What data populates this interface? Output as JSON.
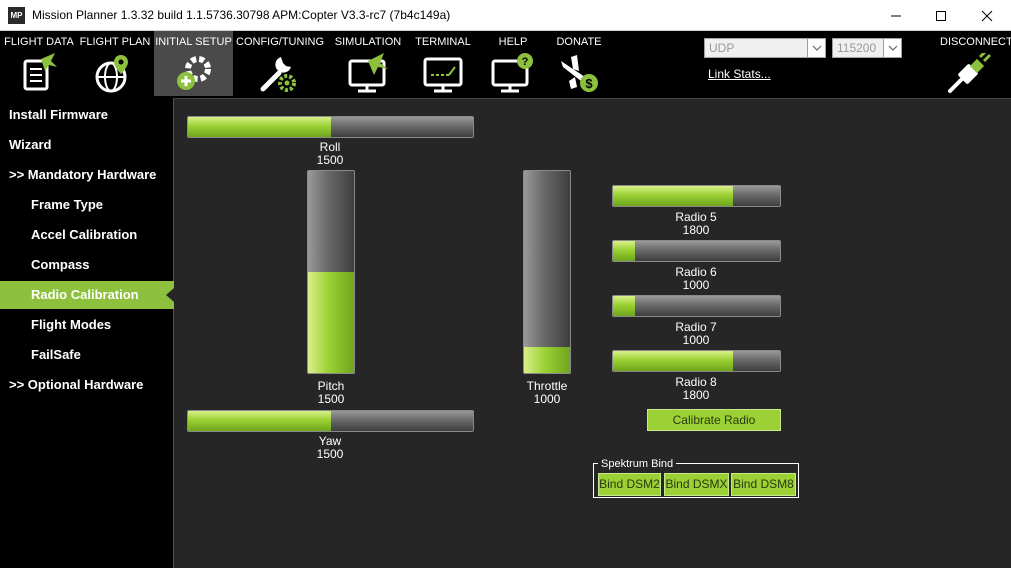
{
  "window": {
    "app_logo": "MP",
    "title": "Mission Planner 1.3.32 build 1.1.5736.30798 APM:Copter V3.3-rc7 (7b4c149a)"
  },
  "menu": [
    {
      "label": "FLIGHT DATA",
      "icon": "flight-data-icon"
    },
    {
      "label": "FLIGHT PLAN",
      "icon": "flight-plan-icon"
    },
    {
      "label": "INITIAL SETUP",
      "icon": "initial-setup-icon"
    },
    {
      "label": "CONFIG/TUNING",
      "icon": "config-tuning-icon"
    },
    {
      "label": "SIMULATION",
      "icon": "simulation-icon"
    },
    {
      "label": "TERMINAL",
      "icon": "terminal-icon"
    },
    {
      "label": "HELP",
      "icon": "help-icon"
    },
    {
      "label": "DONATE",
      "icon": "donate-icon"
    }
  ],
  "connection": {
    "port": "UDP",
    "baud": "115200",
    "link_stats": "Link Stats...",
    "disconnect": "DISCONNECT"
  },
  "sidebar": [
    {
      "label": "Install Firmware"
    },
    {
      "label": "Wizard"
    },
    {
      "label": ">> Mandatory Hardware"
    },
    {
      "label": "Frame Type"
    },
    {
      "label": "Accel Calibration"
    },
    {
      "label": "Compass"
    },
    {
      "label": "Radio Calibration"
    },
    {
      "label": "Flight Modes"
    },
    {
      "label": "FailSafe"
    },
    {
      "label": ">> Optional Hardware"
    }
  ],
  "radio": {
    "range": [
      1000,
      2000
    ],
    "roll": {
      "label": "Roll",
      "value": "1500",
      "level": 0.5
    },
    "pitch": {
      "label": "Pitch",
      "value": "1500",
      "level": 0.5
    },
    "yaw": {
      "label": "Yaw",
      "value": "1500",
      "level": 0.5
    },
    "throttle": {
      "label": "Throttle",
      "value": "1000",
      "level": 0.13
    },
    "radio5": {
      "label": "Radio 5",
      "value": "1800",
      "level": 0.72
    },
    "radio6": {
      "label": "Radio 6",
      "value": "1000",
      "level": 0.13
    },
    "radio7": {
      "label": "Radio 7",
      "value": "1000",
      "level": 0.13
    },
    "radio8": {
      "label": "Radio 8",
      "value": "1800",
      "level": 0.72
    }
  },
  "calibrate_button": "Calibrate Radio",
  "spektrum": {
    "title": "Spektrum Bind",
    "buttons": [
      "Bind DSM2",
      "Bind DSMX",
      "Bind DSM8"
    ]
  },
  "colors": {
    "accent": "#8dc13d",
    "bar_fill": "#9bd134",
    "background": "#262626",
    "menu_background": "#000000"
  }
}
